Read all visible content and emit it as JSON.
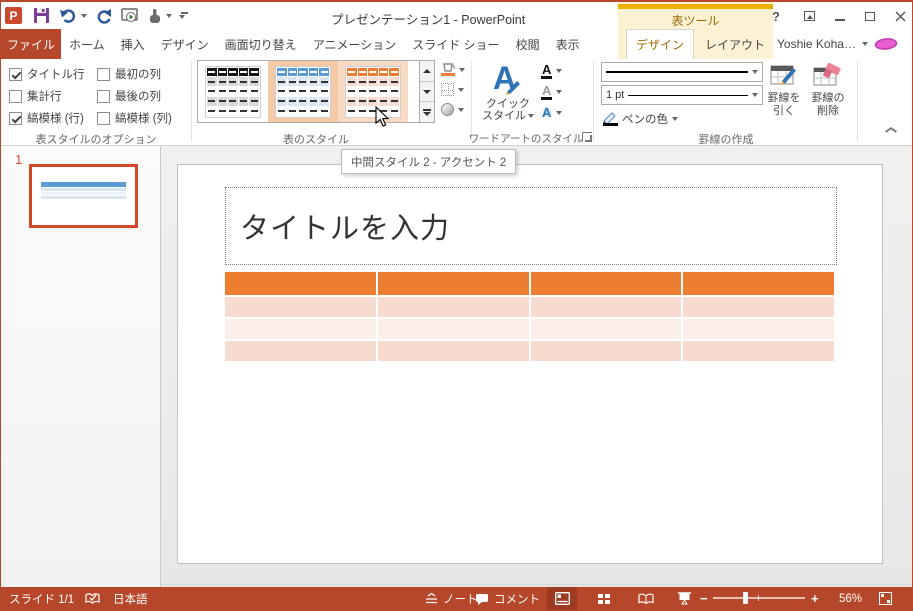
{
  "colors": {
    "accent": "#B7472A",
    "accent_dark": "#9E3A21",
    "gold_bar": "#EFAF00",
    "gold_text": "#9C6B03",
    "contextual_bg": "#FDF2D3",
    "group_label": "#666666",
    "table_header": "#ED7D31",
    "band_dark": "#F7DBCF",
    "band_light": "#FCEFE9",
    "blue_header": "#5B9BD5",
    "blue_band": "#D9E5F2",
    "dark_header": "#151515",
    "gray_band": "#D9D9D9",
    "sel_frame": "#F5C8A6",
    "hover_frame": "#F9DAC3",
    "thumb_border": "#D24726",
    "save_purple": "#7B3E98",
    "undo_blue": "#2B579A",
    "avatar_pink": "#E85FD4"
  },
  "titlebar": {
    "title": "プレゼンテーション1 - PowerPoint",
    "context_header": "表ツール",
    "help_label": "?",
    "user_name": "Yoshie Koha…"
  },
  "qat_icons": [
    "powerpoint-logo",
    "save",
    "undo",
    "redo",
    "start-slideshow",
    "touch-mode",
    "customize-qat"
  ],
  "tabs": {
    "file": "ファイル",
    "main": [
      "ホーム",
      "挿入",
      "デザイン",
      "画面切り替え",
      "アニメーション",
      "スライド ショー",
      "校閲",
      "表示"
    ],
    "contextual_selected": "デザイン",
    "contextual_other": "レイアウト"
  },
  "ribbon": {
    "options": {
      "label": "表スタイルのオプション",
      "items": [
        {
          "label": "タイトル行",
          "checked": true
        },
        {
          "label": "最初の列",
          "checked": false
        },
        {
          "label": "集計行",
          "checked": false
        },
        {
          "label": "最後の列",
          "checked": false
        },
        {
          "label": "縞模様 (行)",
          "checked": true
        },
        {
          "label": "縞模様 (列)",
          "checked": false
        }
      ]
    },
    "styles": {
      "label": "表のスタイル",
      "thumbnails": [
        {
          "style": "dark",
          "state": "normal"
        },
        {
          "style": "blue",
          "state": "selected"
        },
        {
          "style": "orange",
          "state": "hover"
        }
      ]
    },
    "wordart": {
      "label": "ワードアートのスタイル",
      "quick_style_line1": "クイック",
      "quick_style_line2": "スタイル"
    },
    "draw_borders": {
      "label": "罫線の作成",
      "pen_weight": "1 pt",
      "pen_color": "ペンの色",
      "draw_line1": "罫線を",
      "draw_line2": "引く",
      "erase_line1": "罫線の",
      "erase_line2": "削除"
    }
  },
  "tooltip": "中間スタイル 2 - アクセント 2",
  "slides_panel": {
    "slide_number": "1"
  },
  "slide": {
    "title_placeholder": "タイトルを入力",
    "table": {
      "columns": 4,
      "body_rows": 3
    }
  },
  "statusbar": {
    "slides": "スライド 1/1",
    "language": "日本語",
    "notes": "ノート",
    "comments": "コメント",
    "zoom": "56%"
  }
}
